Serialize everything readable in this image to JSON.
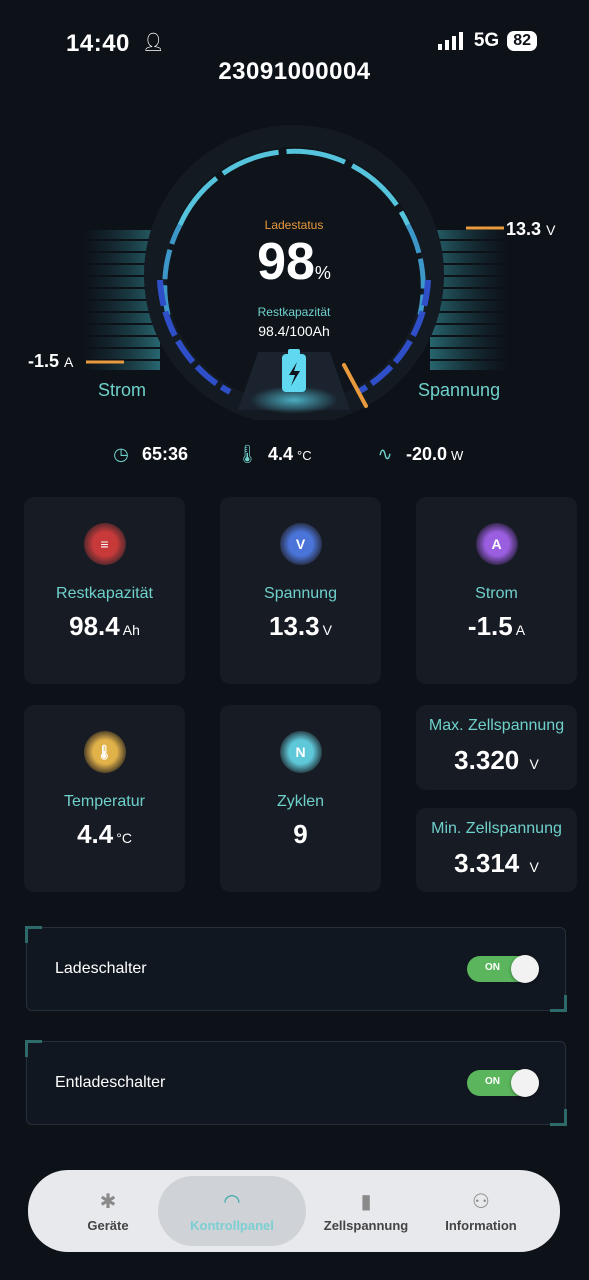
{
  "status_bar": {
    "time": "14:40",
    "network": "5G",
    "battery": "82"
  },
  "device": {
    "title": "23091000004"
  },
  "gauge": {
    "ladestatus_label": "Ladestatus",
    "percent": "98",
    "percent_unit": "%",
    "restkapazitaet_label": "Restkapazität",
    "restkapazitaet_value": "98.4/100Ah",
    "left_value": "-1.5",
    "left_unit": "A",
    "left_label": "Strom",
    "right_value": "13.3",
    "right_unit": "V",
    "right_label": "Spannung"
  },
  "info_row": {
    "time": "65:36",
    "temp": "4.4",
    "temp_unit": "°C",
    "power": "-20.0",
    "power_unit": "W"
  },
  "cards": {
    "restkapazitaet": {
      "label": "Restkapazität",
      "value": "98.4",
      "unit": "Ah"
    },
    "spannung": {
      "label": "Spannung",
      "value": "13.3",
      "unit": "V"
    },
    "strom": {
      "label": "Strom",
      "value": "-1.5",
      "unit": "A"
    },
    "temperatur": {
      "label": "Temperatur",
      "value": "4.4",
      "unit": "°C"
    },
    "zyklen": {
      "label": "Zyklen",
      "value": "9"
    },
    "max_zell": {
      "label": "Max. Zellspannung",
      "value": "3.320",
      "unit": "V"
    },
    "min_zell": {
      "label": "Min. Zellspannung",
      "value": "3.314",
      "unit": "V"
    }
  },
  "switches": {
    "lade": {
      "label": "Ladeschalter",
      "state": "ON"
    },
    "entlade": {
      "label": "Entladeschalter",
      "state": "ON"
    }
  },
  "nav": {
    "items": [
      {
        "label": "Geräte",
        "icon": "bluetooth-icon"
      },
      {
        "label": "Kontrollpanel",
        "icon": "gauge-icon"
      },
      {
        "label": "Zellspannung",
        "icon": "battery-icon"
      },
      {
        "label": "Information",
        "icon": "users-icon"
      }
    ]
  },
  "colors": {
    "accent": "#6fd1cc",
    "orange": "#e89a3c",
    "toggle_on": "#5ab55c"
  }
}
